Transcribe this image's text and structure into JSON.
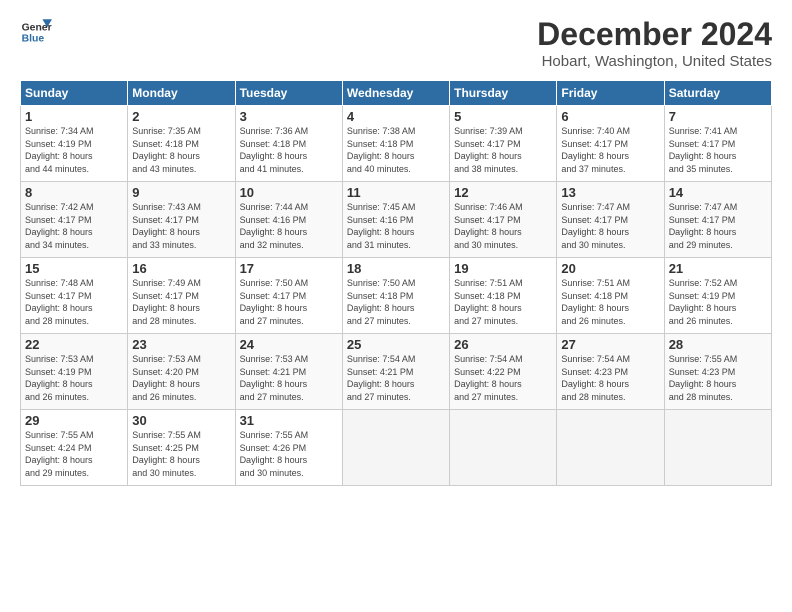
{
  "logo": {
    "line1": "General",
    "line2": "Blue"
  },
  "title": "December 2024",
  "location": "Hobart, Washington, United States",
  "headers": [
    "Sunday",
    "Monday",
    "Tuesday",
    "Wednesday",
    "Thursday",
    "Friday",
    "Saturday"
  ],
  "weeks": [
    [
      {
        "day": "1",
        "info": "Sunrise: 7:34 AM\nSunset: 4:19 PM\nDaylight: 8 hours\nand 44 minutes."
      },
      {
        "day": "2",
        "info": "Sunrise: 7:35 AM\nSunset: 4:18 PM\nDaylight: 8 hours\nand 43 minutes."
      },
      {
        "day": "3",
        "info": "Sunrise: 7:36 AM\nSunset: 4:18 PM\nDaylight: 8 hours\nand 41 minutes."
      },
      {
        "day": "4",
        "info": "Sunrise: 7:38 AM\nSunset: 4:18 PM\nDaylight: 8 hours\nand 40 minutes."
      },
      {
        "day": "5",
        "info": "Sunrise: 7:39 AM\nSunset: 4:17 PM\nDaylight: 8 hours\nand 38 minutes."
      },
      {
        "day": "6",
        "info": "Sunrise: 7:40 AM\nSunset: 4:17 PM\nDaylight: 8 hours\nand 37 minutes."
      },
      {
        "day": "7",
        "info": "Sunrise: 7:41 AM\nSunset: 4:17 PM\nDaylight: 8 hours\nand 35 minutes."
      }
    ],
    [
      {
        "day": "8",
        "info": "Sunrise: 7:42 AM\nSunset: 4:17 PM\nDaylight: 8 hours\nand 34 minutes."
      },
      {
        "day": "9",
        "info": "Sunrise: 7:43 AM\nSunset: 4:17 PM\nDaylight: 8 hours\nand 33 minutes."
      },
      {
        "day": "10",
        "info": "Sunrise: 7:44 AM\nSunset: 4:16 PM\nDaylight: 8 hours\nand 32 minutes."
      },
      {
        "day": "11",
        "info": "Sunrise: 7:45 AM\nSunset: 4:16 PM\nDaylight: 8 hours\nand 31 minutes."
      },
      {
        "day": "12",
        "info": "Sunrise: 7:46 AM\nSunset: 4:17 PM\nDaylight: 8 hours\nand 30 minutes."
      },
      {
        "day": "13",
        "info": "Sunrise: 7:47 AM\nSunset: 4:17 PM\nDaylight: 8 hours\nand 30 minutes."
      },
      {
        "day": "14",
        "info": "Sunrise: 7:47 AM\nSunset: 4:17 PM\nDaylight: 8 hours\nand 29 minutes."
      }
    ],
    [
      {
        "day": "15",
        "info": "Sunrise: 7:48 AM\nSunset: 4:17 PM\nDaylight: 8 hours\nand 28 minutes."
      },
      {
        "day": "16",
        "info": "Sunrise: 7:49 AM\nSunset: 4:17 PM\nDaylight: 8 hours\nand 28 minutes."
      },
      {
        "day": "17",
        "info": "Sunrise: 7:50 AM\nSunset: 4:17 PM\nDaylight: 8 hours\nand 27 minutes."
      },
      {
        "day": "18",
        "info": "Sunrise: 7:50 AM\nSunset: 4:18 PM\nDaylight: 8 hours\nand 27 minutes."
      },
      {
        "day": "19",
        "info": "Sunrise: 7:51 AM\nSunset: 4:18 PM\nDaylight: 8 hours\nand 27 minutes."
      },
      {
        "day": "20",
        "info": "Sunrise: 7:51 AM\nSunset: 4:18 PM\nDaylight: 8 hours\nand 26 minutes."
      },
      {
        "day": "21",
        "info": "Sunrise: 7:52 AM\nSunset: 4:19 PM\nDaylight: 8 hours\nand 26 minutes."
      }
    ],
    [
      {
        "day": "22",
        "info": "Sunrise: 7:53 AM\nSunset: 4:19 PM\nDaylight: 8 hours\nand 26 minutes."
      },
      {
        "day": "23",
        "info": "Sunrise: 7:53 AM\nSunset: 4:20 PM\nDaylight: 8 hours\nand 26 minutes."
      },
      {
        "day": "24",
        "info": "Sunrise: 7:53 AM\nSunset: 4:21 PM\nDaylight: 8 hours\nand 27 minutes."
      },
      {
        "day": "25",
        "info": "Sunrise: 7:54 AM\nSunset: 4:21 PM\nDaylight: 8 hours\nand 27 minutes."
      },
      {
        "day": "26",
        "info": "Sunrise: 7:54 AM\nSunset: 4:22 PM\nDaylight: 8 hours\nand 27 minutes."
      },
      {
        "day": "27",
        "info": "Sunrise: 7:54 AM\nSunset: 4:23 PM\nDaylight: 8 hours\nand 28 minutes."
      },
      {
        "day": "28",
        "info": "Sunrise: 7:55 AM\nSunset: 4:23 PM\nDaylight: 8 hours\nand 28 minutes."
      }
    ],
    [
      {
        "day": "29",
        "info": "Sunrise: 7:55 AM\nSunset: 4:24 PM\nDaylight: 8 hours\nand 29 minutes."
      },
      {
        "day": "30",
        "info": "Sunrise: 7:55 AM\nSunset: 4:25 PM\nDaylight: 8 hours\nand 30 minutes."
      },
      {
        "day": "31",
        "info": "Sunrise: 7:55 AM\nSunset: 4:26 PM\nDaylight: 8 hours\nand 30 minutes."
      },
      null,
      null,
      null,
      null
    ]
  ]
}
